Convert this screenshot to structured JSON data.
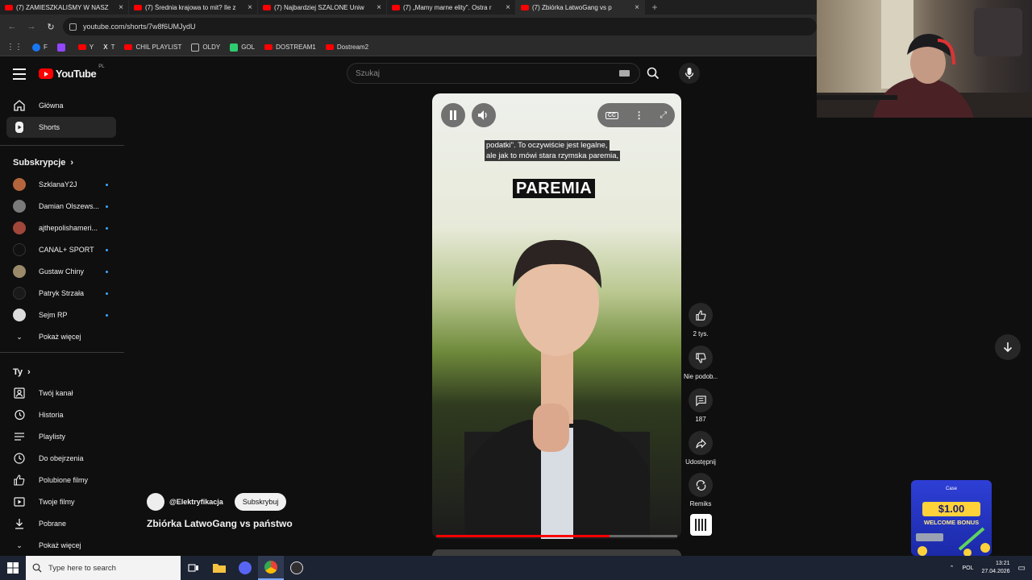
{
  "browser": {
    "tabs": [
      {
        "label": "(7) ZAMIESZKALIŚMY W NASZ"
      },
      {
        "label": "(7) Średnia krajowa to mit? Ile z"
      },
      {
        "label": "(7) Najbardziej SZALONE Uniw"
      },
      {
        "label": "(7) „Mamy marne elity\". Ostra r"
      },
      {
        "label": "(7) Zbiórka LatwoGang vs p"
      }
    ],
    "url": "youtube.com/shorts/7w8f6UMJydU",
    "bookmarks": [
      {
        "label": "F",
        "color": "#1877f2"
      },
      {
        "label": "",
        "color": "#9146ff"
      },
      {
        "label": "Y",
        "color": "#ff0000"
      },
      {
        "label": "T",
        "color": "#ffffff"
      },
      {
        "label": "CHIL PLAYLIST",
        "color": "#ff0000"
      },
      {
        "label": "OLDY",
        "color": "#aaaaaa"
      },
      {
        "label": "GOL",
        "color": "#2ecc71"
      },
      {
        "label": "DOSTREAM1",
        "color": "#ff0000"
      },
      {
        "label": "Dostream2",
        "color": "#ff0000"
      }
    ]
  },
  "youtube": {
    "logo": "YouTube",
    "region": "PL",
    "search_placeholder": "Szukaj"
  },
  "sidebar": {
    "main": [
      {
        "label": "Główna",
        "icon": "home-icon"
      },
      {
        "label": "Shorts",
        "icon": "shorts-icon",
        "active": true
      }
    ],
    "subs_header": "Subskrypcje",
    "subs": [
      {
        "label": "SzklanaY2J",
        "color": "#b5653c"
      },
      {
        "label": "Damian Olszews...",
        "color": "#7a7a7a"
      },
      {
        "label": "ajthepolishameri...",
        "color": "#a0463a"
      },
      {
        "label": "CANAL+ SPORT",
        "color": "#111111"
      },
      {
        "label": "Gustaw Chiny",
        "color": "#9a8a6a"
      },
      {
        "label": "Patryk Strzała",
        "color": "#1a1a1a"
      },
      {
        "label": "Sejm RP",
        "color": "#dddddd"
      }
    ],
    "show_more_1": "Pokaż więcej",
    "you_header": "Ty",
    "you": [
      {
        "label": "Twój kanał",
        "icon": "user-icon"
      },
      {
        "label": "Historia",
        "icon": "history-icon"
      },
      {
        "label": "Playlisty",
        "icon": "playlist-icon"
      },
      {
        "label": "Do obejrzenia",
        "icon": "clock-icon"
      },
      {
        "label": "Polubione filmy",
        "icon": "thumbs-up-icon"
      },
      {
        "label": "Twoje filmy",
        "icon": "video-icon"
      },
      {
        "label": "Pobrane",
        "icon": "download-icon"
      }
    ],
    "show_more_2": "Pokaż więcej"
  },
  "video": {
    "caption_line1": "podatki\". To oczywiście jest legalne,",
    "caption_line2": "ale jak to mówi stara rzymska paremia,",
    "big_word": "PAREMIA",
    "progress": 0.72,
    "channel": "@Elektryfikacja",
    "subscribe": "Subskrybuj",
    "title": "Zbiórka LatwoGang vs państwo"
  },
  "actions": {
    "likes": "2 tys.",
    "dislike": "Nie podob...",
    "comments": "187",
    "share": "Udostępnij",
    "remix": "Remiks"
  },
  "ad": {
    "brand": "Case",
    "price": "$1.00",
    "bonus": "WELCOME BONUS"
  },
  "taskbar": {
    "search_placeholder": "Type here to search",
    "lang": "POL",
    "time": "13:21",
    "date": "27.04.2026"
  },
  "colors": {
    "accent": "#ff0000",
    "background": "#0f0f0f",
    "link": "#3ea6ff"
  }
}
